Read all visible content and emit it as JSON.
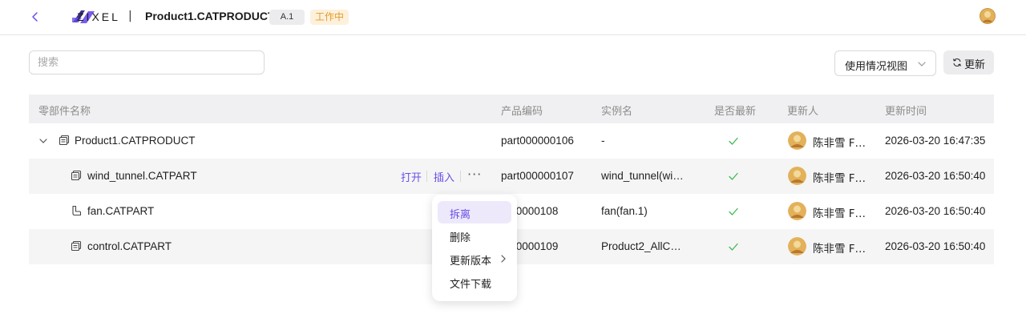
{
  "header": {
    "brand": "ZIXEL",
    "separator": "|",
    "document_title": "Product1.CATPRODUCT",
    "version_badge": "A.1",
    "status_badge": "工作中"
  },
  "toolbar": {
    "search_placeholder": "搜索",
    "view_select_value": "使用情况视图",
    "refresh_label": "更新"
  },
  "table": {
    "columns": [
      "零部件名称",
      "产品编码",
      "实例名",
      "是否最新",
      "更新人",
      "更新时间"
    ],
    "rows": [
      {
        "name": "Product1.CATPRODUCT",
        "code": "part000000106",
        "instance": "-",
        "updater": "陈非雪 F…",
        "time": "2026-03-20 16:47:35",
        "latest": true
      },
      {
        "name": "wind_tunnel.CATPART",
        "code": "part000000107",
        "instance": "wind_tunnel(wi…",
        "updater": "陈非雪 F…",
        "time": "2026-03-20 16:50:40",
        "latest": true
      },
      {
        "name": "fan.CATPART",
        "code": ":000000108",
        "instance": "fan(fan.1)",
        "updater": "陈非雪 F…",
        "time": "2026-03-20 16:50:40",
        "latest": true
      },
      {
        "name": "control.CATPART",
        "code": ":000000109",
        "instance": "Product2_AllC…",
        "updater": "陈非雪 F…",
        "time": "2026-03-20 16:50:40",
        "latest": true
      }
    ],
    "row_actions": {
      "open": "打开",
      "insert": "插入",
      "more": "···"
    }
  },
  "context_menu": {
    "items": [
      "拆离",
      "删除",
      "更新版本",
      "文件下载"
    ],
    "active_index": 0
  },
  "colors": {
    "accent": "#6b4ee6",
    "status_text": "#e59a2b",
    "status_bg": "#fdf1dc",
    "check": "#3fb950"
  }
}
